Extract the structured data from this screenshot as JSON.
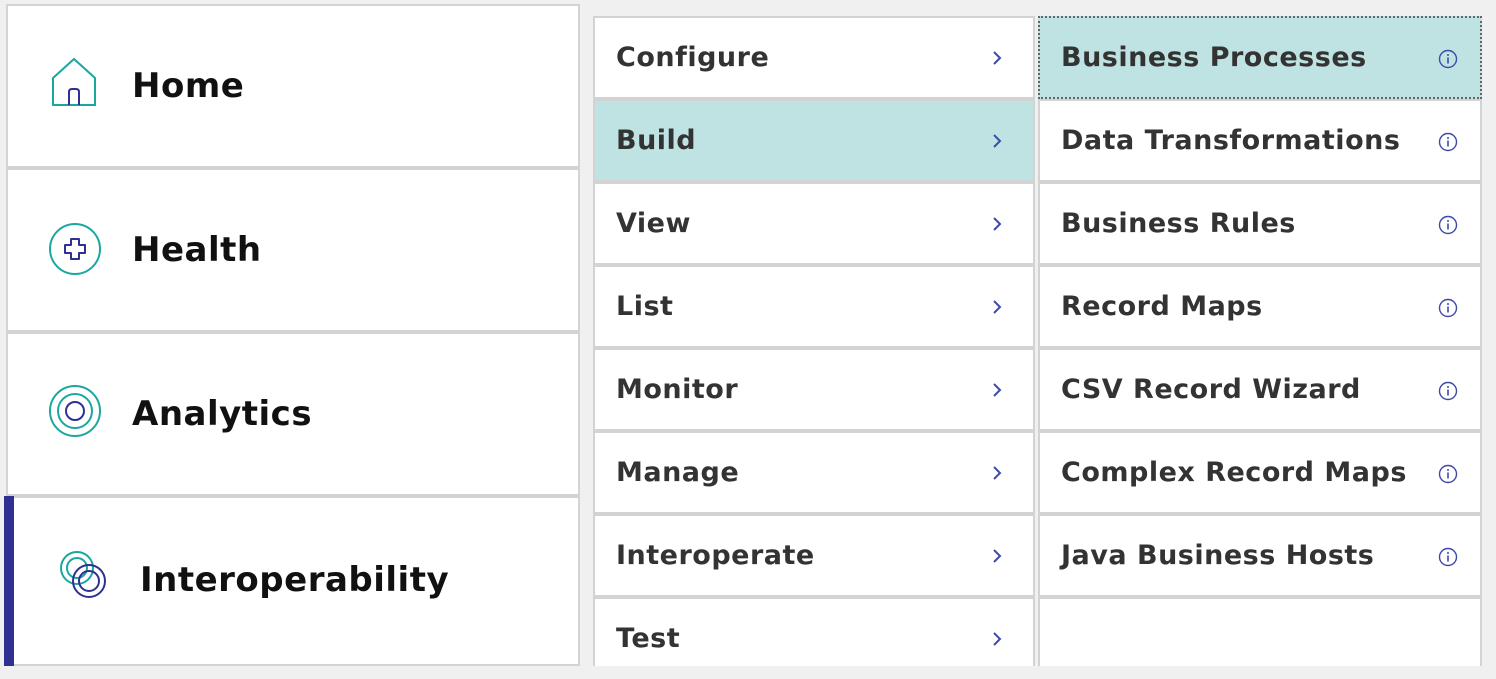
{
  "main_nav": {
    "items": [
      {
        "label": "Home",
        "icon": "home-icon"
      },
      {
        "label": "Health",
        "icon": "health-plus-icon"
      },
      {
        "label": "Analytics",
        "icon": "analytics-target-icon"
      },
      {
        "label": "Interoperability",
        "icon": "interoperability-rings-icon",
        "active": true
      }
    ]
  },
  "sub_menu": {
    "items": [
      {
        "label": "Configure"
      },
      {
        "label": "Build",
        "selected": true
      },
      {
        "label": "View"
      },
      {
        "label": "List"
      },
      {
        "label": "Monitor"
      },
      {
        "label": "Manage"
      },
      {
        "label": "Interoperate"
      },
      {
        "label": "Test"
      }
    ]
  },
  "item_menu": {
    "items": [
      {
        "label": "Business Processes",
        "selected": true
      },
      {
        "label": "Data Transformations"
      },
      {
        "label": "Business Rules"
      },
      {
        "label": "Record Maps"
      },
      {
        "label": "CSV Record Wizard"
      },
      {
        "label": "Complex Record Maps"
      },
      {
        "label": "Java Business Hosts"
      }
    ]
  },
  "colors": {
    "accent_teal": "#1aa7a0",
    "accent_navy": "#2e3192",
    "selected_bg": "#bfe3e3",
    "chevron": "#3f4aa8"
  }
}
